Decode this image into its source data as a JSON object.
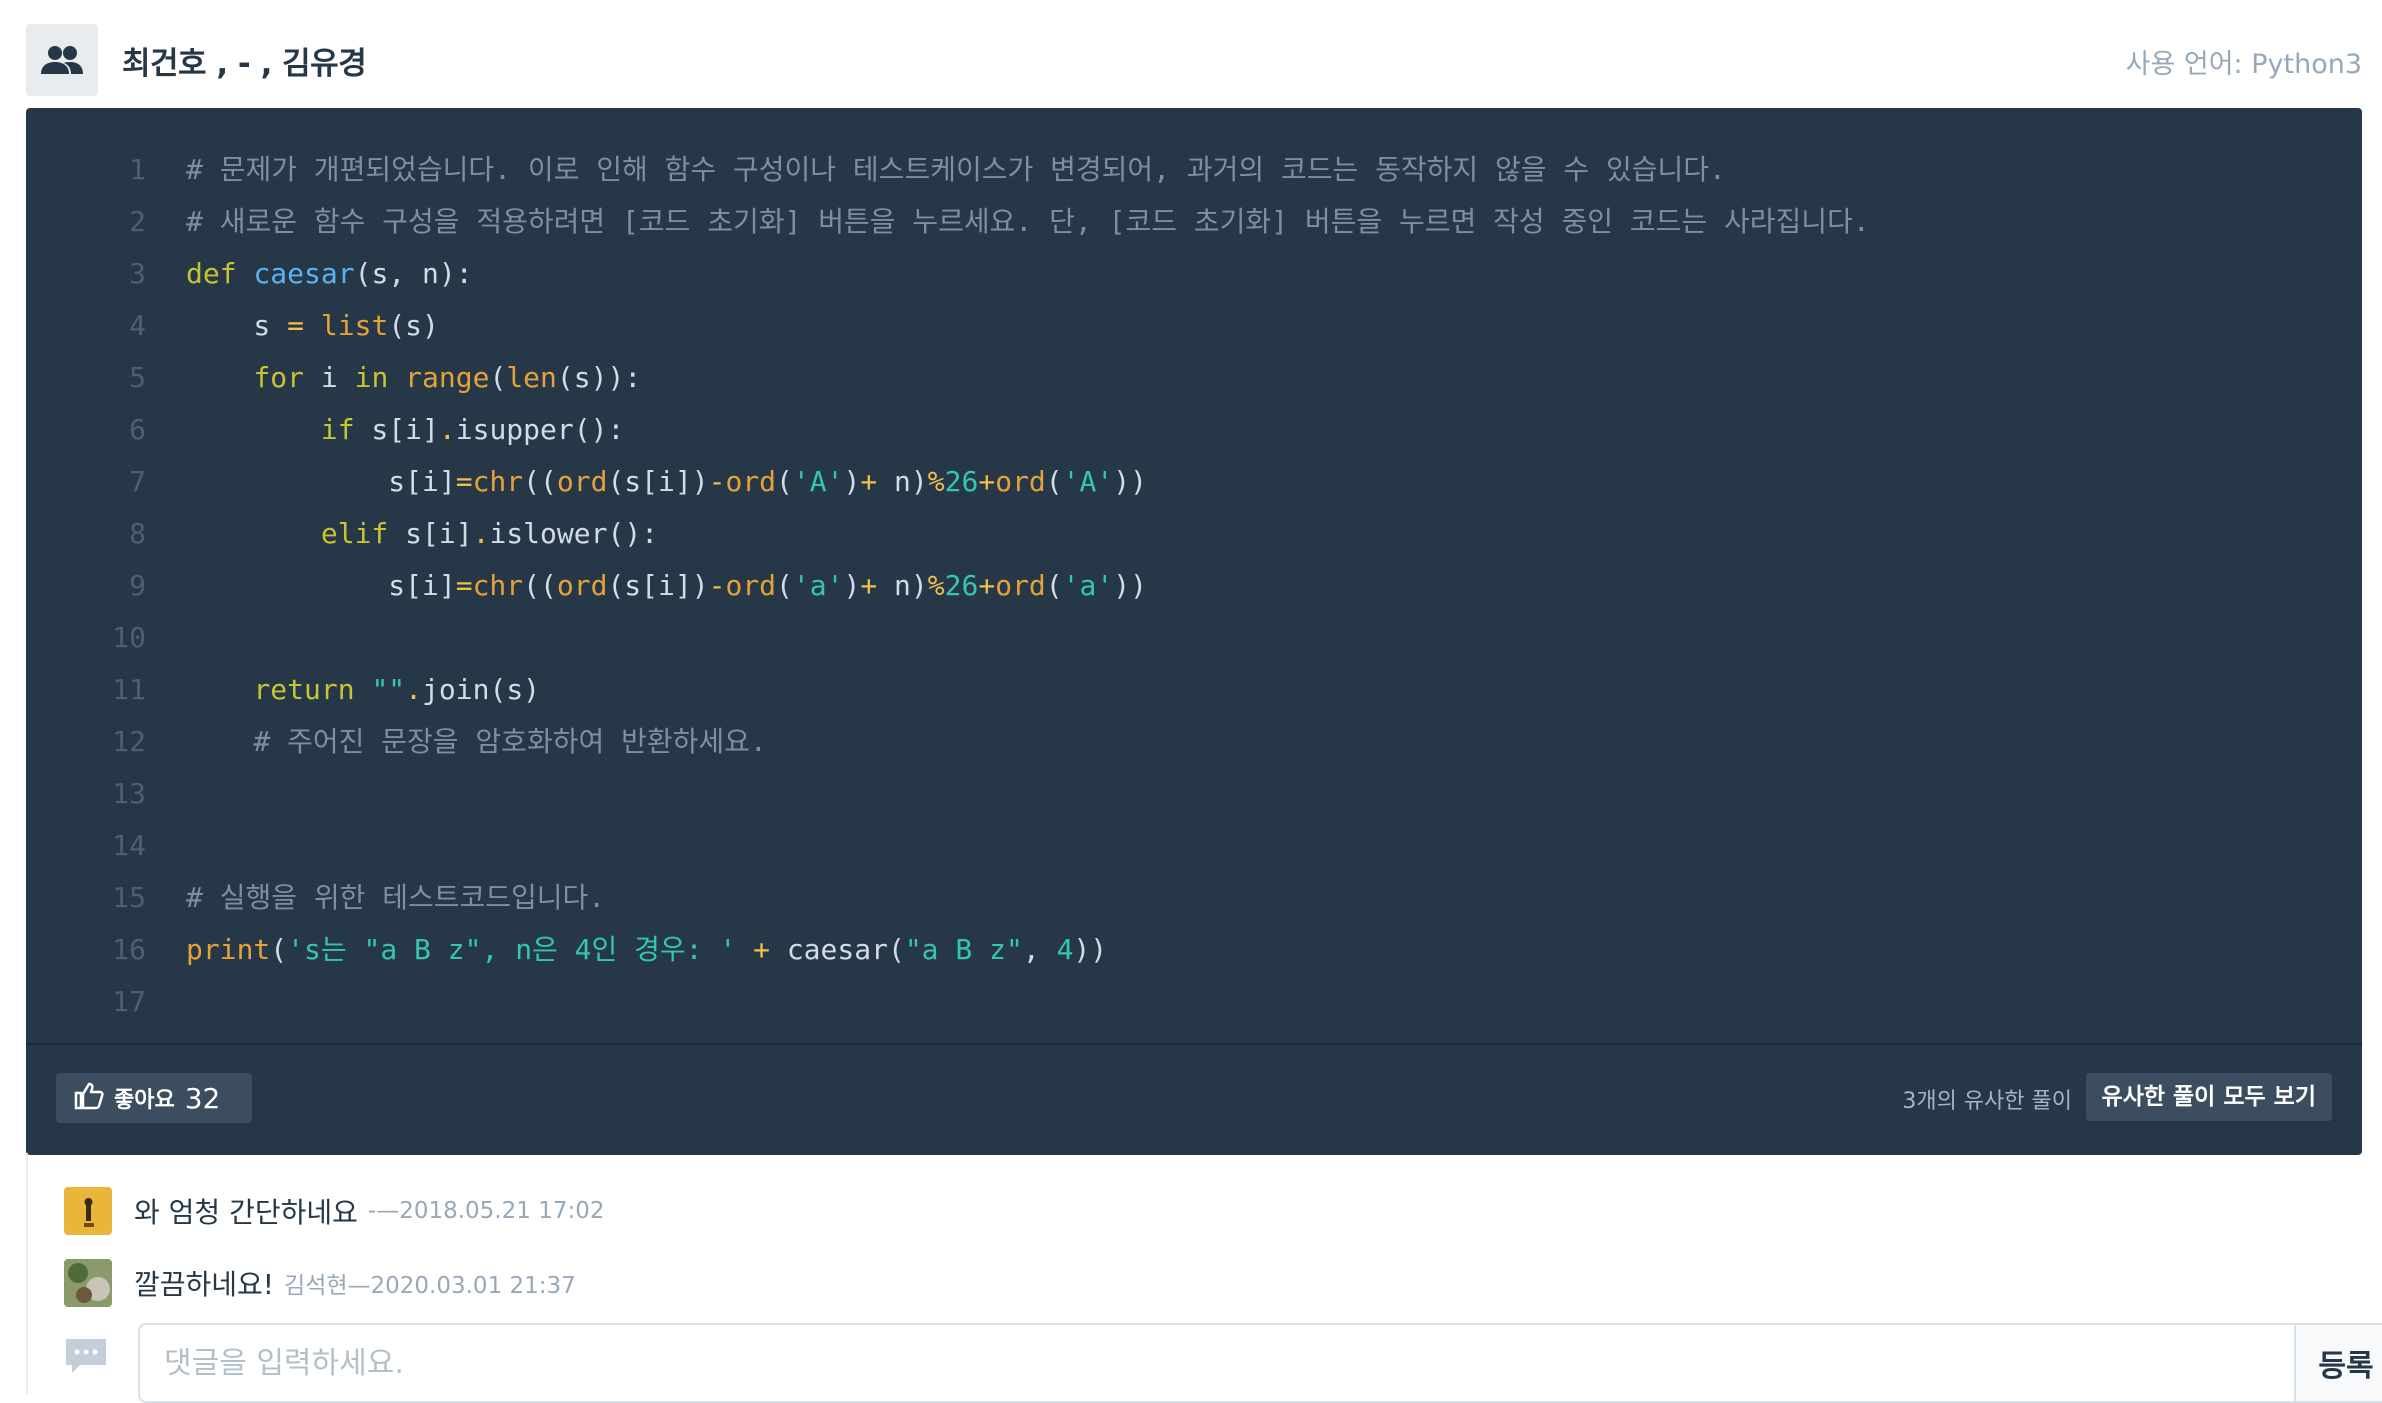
{
  "header": {
    "authors": "최건호 , - , 김유경",
    "language": "사용 언어: Python3"
  },
  "code": {
    "line_numbers": [
      "1",
      "2",
      "3",
      "4",
      "5",
      "6",
      "7",
      "8",
      "9",
      "10",
      "11",
      "12",
      "13",
      "14",
      "15",
      "16",
      "17"
    ],
    "lines": [
      "# 문제가 개편되었습니다. 이로 인해 함수 구성이나 테스트케이스가 변경되어, 과거의 코드는 동작하지 않을 수 있습니다.",
      "# 새로운 함수 구성을 적용하려면 [코드 초기화] 버튼을 누르세요. 단, [코드 초기화] 버튼을 누르면 작성 중인 코드는 사라집니다.",
      "def caesar(s, n):",
      "    s = list(s)",
      "    for i in range(len(s)):",
      "        if s[i].isupper():",
      "            s[i]=chr((ord(s[i])-ord('A')+ n)%26+ord('A'))",
      "        elif s[i].islower():",
      "            s[i]=chr((ord(s[i])-ord('a')+ n)%26+ord('a'))",
      "",
      "    return \"\".join(s)",
      "    # 주어진 문장을 암호화하여 반환하세요.",
      "",
      "",
      "# 실행을 위한 테스트코드입니다.",
      "print('s는 \"a B z\", n은 4인 경우: ' + caesar(\"a B z\", 4))",
      ""
    ]
  },
  "footer": {
    "like_label": "좋아요",
    "like_count": "32",
    "similar_count_text": "3개의 유사한 풀이",
    "similar_button": "유사한 풀이 모두 보기"
  },
  "comments": [
    {
      "text": "와 엄청 간단하네요",
      "meta": "-—2018.05.21 17:02"
    },
    {
      "text": "깔끔하네요!",
      "meta": "김석현—2020.03.01 21:37"
    }
  ],
  "comment_form": {
    "placeholder": "댓글을 입력하세요.",
    "submit_label": "등록"
  },
  "icons": {
    "group": "users-icon",
    "like": "thumbs-up-icon",
    "comment": "speech-bubble-icon"
  }
}
